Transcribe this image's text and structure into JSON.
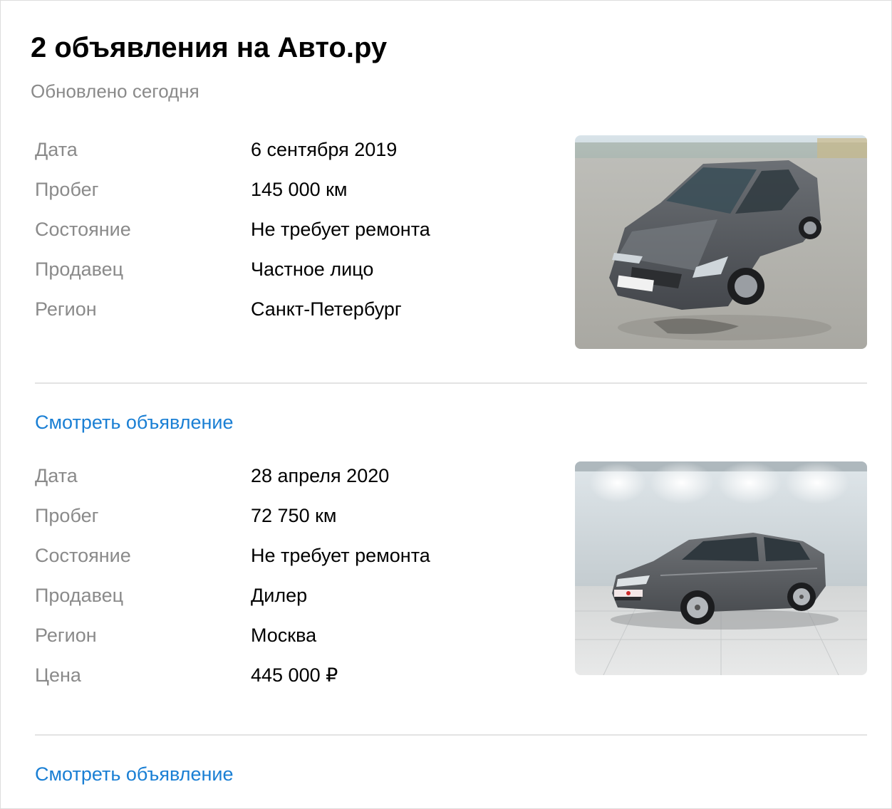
{
  "header": {
    "title": "2 объявления на Авто.ру",
    "subtitle": "Обновлено сегодня"
  },
  "listings": [
    {
      "rows": [
        {
          "label": "Дата",
          "value": "6 сентября 2019"
        },
        {
          "label": "Пробег",
          "value": "145 000 км"
        },
        {
          "label": "Состояние",
          "value": "Не требует ремонта"
        },
        {
          "label": "Продавец",
          "value": "Частное лицо"
        },
        {
          "label": "Регион",
          "value": "Санкт-Петербург"
        }
      ],
      "photo": "car-photo-parking-lot",
      "link_label": "Смотреть объявление"
    },
    {
      "rows": [
        {
          "label": "Дата",
          "value": "28 апреля 2020"
        },
        {
          "label": "Пробег",
          "value": "72 750 км"
        },
        {
          "label": "Состояние",
          "value": "Не требует ремонта"
        },
        {
          "label": "Продавец",
          "value": "Дилер"
        },
        {
          "label": "Регион",
          "value": "Москва"
        },
        {
          "label": "Цена",
          "value": "445 000 ₽"
        }
      ],
      "photo": "car-photo-showroom",
      "link_label": "Смотреть объявление"
    }
  ],
  "colors": {
    "link": "#1a7fd4",
    "label": "#8a8a8a",
    "value": "#000000",
    "divider": "#e3e3e3"
  }
}
